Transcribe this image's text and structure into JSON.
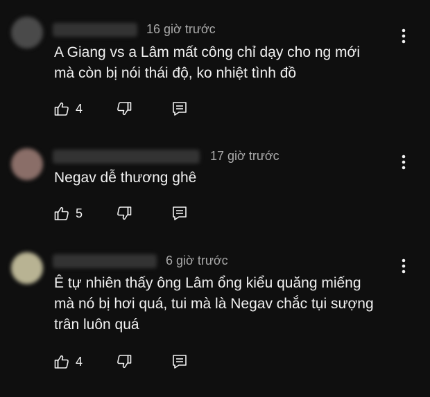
{
  "comments": [
    {
      "timestamp": "16 giờ trước",
      "text_lines": [
        "A Giang vs a Lâm mất công chỉ dạy cho ng mới",
        "mà còn bị nói thái độ, ko nhiệt tình đồ"
      ],
      "likes": "4"
    },
    {
      "timestamp": "17 giờ trước",
      "text_lines": [
        "Negav dễ thương ghê"
      ],
      "likes": "5"
    },
    {
      "timestamp": "6 giờ trước",
      "text_lines": [
        "Ê tự nhiên thấy ông Lâm ổng kiểu quăng miếng",
        "mà nó bị hơi quá, tui mà là Negav chắc tụi sượng",
        "trân luôn quá"
      ],
      "likes": "4"
    }
  ],
  "icons": {
    "like": "thumb-up-icon",
    "dislike": "thumb-down-icon",
    "reply": "reply-icon",
    "more": "more-vertical-icon"
  },
  "colors": {
    "background": "#0f0f0f",
    "text": "#f1f1f1",
    "secondary_text": "#aaaaaa"
  }
}
